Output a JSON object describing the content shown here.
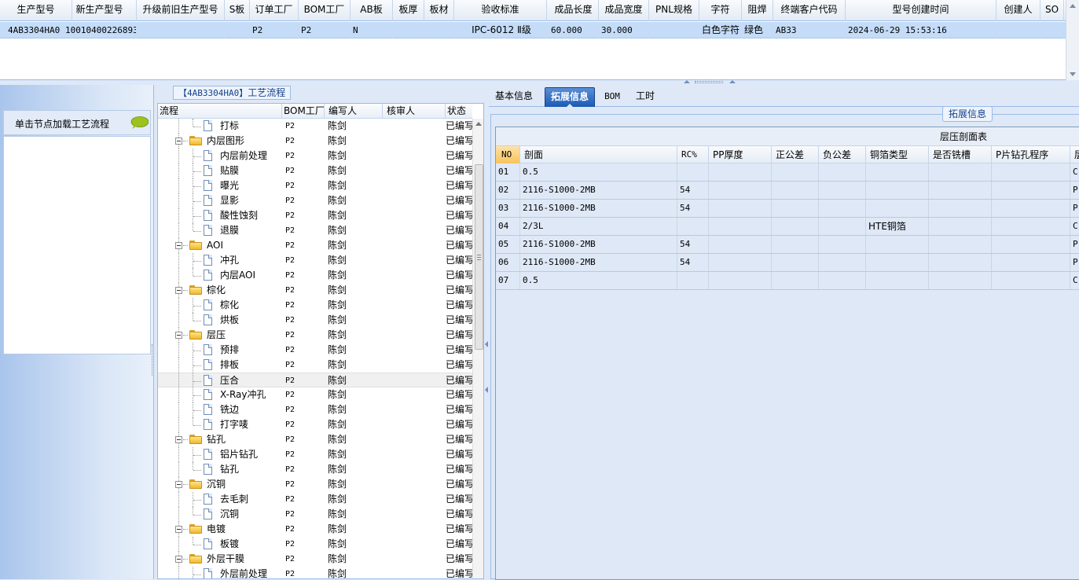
{
  "top_grid": {
    "columns": [
      "生产型号",
      "新生产型号",
      "升级前旧生产型号",
      "S板",
      "订单工厂",
      "BOM工厂",
      "AB板",
      "板厚",
      "板材",
      "验收标准",
      "成品长度",
      "成品宽度",
      "PNL规格",
      "字符",
      "阻焊",
      "终端客户代码",
      "型号创建时间",
      "创建人",
      "SO"
    ],
    "row": [
      "4AB3304HA0",
      "10010400226893",
      "",
      "",
      "P2",
      "P2",
      "N",
      "",
      "",
      "IPC-6012 Ⅱ级",
      "60.000",
      "30.000",
      "",
      "白色字符",
      "绿色",
      "AB33",
      "2024-06-29 15:53:16",
      "",
      ""
    ]
  },
  "side_panel": {
    "header_text": "单击节点加载工艺流程",
    "icon": "speech-bubble-icon"
  },
  "tree_panel": {
    "title_model": "4AB3304HA0",
    "title_suffix": "工艺流程",
    "columns": [
      "流程",
      "BOM工厂",
      "编写人",
      "核审人",
      "状态"
    ],
    "rows": [
      {
        "name": "打标",
        "type": "doc",
        "level": 1,
        "bom": "P2",
        "author": "陈剑",
        "reviewer": "",
        "status": "已编写",
        "last": true
      },
      {
        "name": "内层图形",
        "type": "folder",
        "level": 0,
        "bom": "P2",
        "author": "陈剑",
        "reviewer": "",
        "status": "已编写"
      },
      {
        "name": "内层前处理",
        "type": "doc",
        "level": 1,
        "bom": "P2",
        "author": "陈剑",
        "reviewer": "",
        "status": "已编写"
      },
      {
        "name": "贴膜",
        "type": "doc",
        "level": 1,
        "bom": "P2",
        "author": "陈剑",
        "reviewer": "",
        "status": "已编写"
      },
      {
        "name": "曝光",
        "type": "doc",
        "level": 1,
        "bom": "P2",
        "author": "陈剑",
        "reviewer": "",
        "status": "已编写"
      },
      {
        "name": "显影",
        "type": "doc",
        "level": 1,
        "bom": "P2",
        "author": "陈剑",
        "reviewer": "",
        "status": "已编写"
      },
      {
        "name": "酸性蚀刻",
        "type": "doc",
        "level": 1,
        "bom": "P2",
        "author": "陈剑",
        "reviewer": "",
        "status": "已编写"
      },
      {
        "name": "退膜",
        "type": "doc",
        "level": 1,
        "bom": "P2",
        "author": "陈剑",
        "reviewer": "",
        "status": "已编写",
        "last": true
      },
      {
        "name": "AOI",
        "type": "folder",
        "level": 0,
        "bom": "P2",
        "author": "陈剑",
        "reviewer": "",
        "status": "已编写"
      },
      {
        "name": "冲孔",
        "type": "doc",
        "level": 1,
        "bom": "P2",
        "author": "陈剑",
        "reviewer": "",
        "status": "已编写"
      },
      {
        "name": "内层AOI",
        "type": "doc",
        "level": 1,
        "bom": "P2",
        "author": "陈剑",
        "reviewer": "",
        "status": "已编写",
        "last": true
      },
      {
        "name": "棕化",
        "type": "folder",
        "level": 0,
        "bom": "P2",
        "author": "陈剑",
        "reviewer": "",
        "status": "已编写"
      },
      {
        "name": "棕化",
        "type": "doc",
        "level": 1,
        "bom": "P2",
        "author": "陈剑",
        "reviewer": "",
        "status": "已编写"
      },
      {
        "name": "烘板",
        "type": "doc",
        "level": 1,
        "bom": "P2",
        "author": "陈剑",
        "reviewer": "",
        "status": "已编写",
        "last": true
      },
      {
        "name": "层压",
        "type": "folder",
        "level": 0,
        "bom": "P2",
        "author": "陈剑",
        "reviewer": "",
        "status": "已编写"
      },
      {
        "name": "预排",
        "type": "doc",
        "level": 1,
        "bom": "P2",
        "author": "陈剑",
        "reviewer": "",
        "status": "已编写"
      },
      {
        "name": "排板",
        "type": "doc",
        "level": 1,
        "bom": "P2",
        "author": "陈剑",
        "reviewer": "",
        "status": "已编写"
      },
      {
        "name": "压合",
        "type": "doc",
        "level": 1,
        "bom": "P2",
        "author": "陈剑",
        "reviewer": "",
        "status": "已编写",
        "selected": true
      },
      {
        "name": "X-Ray冲孔",
        "type": "doc",
        "level": 1,
        "bom": "P2",
        "author": "陈剑",
        "reviewer": "",
        "status": "已编写"
      },
      {
        "name": "铣边",
        "type": "doc",
        "level": 1,
        "bom": "P2",
        "author": "陈剑",
        "reviewer": "",
        "status": "已编写"
      },
      {
        "name": "打字唛",
        "type": "doc",
        "level": 1,
        "bom": "P2",
        "author": "陈剑",
        "reviewer": "",
        "status": "已编写",
        "last": true
      },
      {
        "name": "钻孔",
        "type": "folder",
        "level": 0,
        "bom": "P2",
        "author": "陈剑",
        "reviewer": "",
        "status": "已编写"
      },
      {
        "name": "铝片钻孔",
        "type": "doc",
        "level": 1,
        "bom": "P2",
        "author": "陈剑",
        "reviewer": "",
        "status": "已编写"
      },
      {
        "name": "钻孔",
        "type": "doc",
        "level": 1,
        "bom": "P2",
        "author": "陈剑",
        "reviewer": "",
        "status": "已编写",
        "last": true
      },
      {
        "name": "沉铜",
        "type": "folder",
        "level": 0,
        "bom": "P2",
        "author": "陈剑",
        "reviewer": "",
        "status": "已编写"
      },
      {
        "name": "去毛刺",
        "type": "doc",
        "level": 1,
        "bom": "P2",
        "author": "陈剑",
        "reviewer": "",
        "status": "已编写"
      },
      {
        "name": "沉铜",
        "type": "doc",
        "level": 1,
        "bom": "P2",
        "author": "陈剑",
        "reviewer": "",
        "status": "已编写",
        "last": true
      },
      {
        "name": "电镀",
        "type": "folder",
        "level": 0,
        "bom": "P2",
        "author": "陈剑",
        "reviewer": "",
        "status": "已编写"
      },
      {
        "name": "板镀",
        "type": "doc",
        "level": 1,
        "bom": "P2",
        "author": "陈剑",
        "reviewer": "",
        "status": "已编写",
        "last": true
      },
      {
        "name": "外层干膜",
        "type": "folder",
        "level": 0,
        "bom": "P2",
        "author": "陈剑",
        "reviewer": "",
        "status": "已编写"
      },
      {
        "name": "外层前处理",
        "type": "doc",
        "level": 1,
        "bom": "P2",
        "author": "陈剑",
        "reviewer": "",
        "status": "已编写"
      }
    ]
  },
  "detail_panel": {
    "tabs": [
      "基本信息",
      "拓展信息",
      "BOM",
      "工时"
    ],
    "active_tab": 1,
    "section_title": "拓展信息",
    "table_title": "层压剖面表",
    "columns": [
      "NO",
      "剖面",
      "RC%",
      "PP厚度",
      "正公差",
      "负公差",
      "铜箔类型",
      "是否铣槽",
      "P片钻孔程序",
      "层"
    ],
    "rows": [
      [
        "01",
        "0.5",
        "",
        "",
        "",
        "",
        "",
        "",
        "",
        "C"
      ],
      [
        "02",
        "2116-S1000-2MB",
        "54",
        "",
        "",
        "",
        "",
        "",
        "",
        "P"
      ],
      [
        "03",
        "2116-S1000-2MB",
        "54",
        "",
        "",
        "",
        "",
        "",
        "",
        "P"
      ],
      [
        "04",
        "2/3L",
        "",
        "",
        "",
        "",
        "HTE铜箔",
        "",
        "",
        "C"
      ],
      [
        "05",
        "2116-S1000-2MB",
        "54",
        "",
        "",
        "",
        "",
        "",
        "",
        "P"
      ],
      [
        "06",
        "2116-S1000-2MB",
        "54",
        "",
        "",
        "",
        "",
        "",
        "",
        "P"
      ],
      [
        "07",
        "0.5",
        "",
        "",
        "",
        "",
        "",
        "",
        "",
        "C"
      ]
    ]
  }
}
